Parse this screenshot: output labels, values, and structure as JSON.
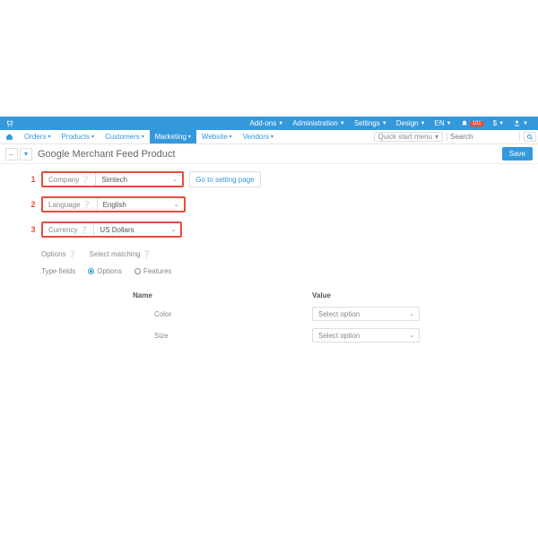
{
  "topbar": {
    "items": [
      {
        "label": "Add-ons"
      },
      {
        "label": "Administration"
      },
      {
        "label": "Settings"
      },
      {
        "label": "Design"
      },
      {
        "label": "EN"
      }
    ],
    "notifications": "101",
    "currency": "$"
  },
  "mainnav": {
    "items": [
      {
        "label": "Orders"
      },
      {
        "label": "Products"
      },
      {
        "label": "Customers"
      },
      {
        "label": "Marketing",
        "active": true
      },
      {
        "label": "Website"
      },
      {
        "label": "Vendors"
      }
    ],
    "quickstart": "Quick start menu",
    "search_placeholder": "Search"
  },
  "page": {
    "title": "Google Merchant Feed Product",
    "save": "Save"
  },
  "form": {
    "rows": [
      {
        "num": "1",
        "label": "Company",
        "value": "Simtech"
      },
      {
        "num": "2",
        "label": "Language",
        "value": "English"
      },
      {
        "num": "3",
        "label": "Currency",
        "value": "US Dollars"
      }
    ],
    "setting_link": "Go to setting page",
    "options_label": "Options",
    "matching_label": "Select matching",
    "typefields_label": "Type fields",
    "radio_options": "Options",
    "radio_features": "Features",
    "col_name": "Name",
    "col_value": "Value",
    "select_option": "Select option",
    "attrs": [
      "Color",
      "Size"
    ]
  }
}
